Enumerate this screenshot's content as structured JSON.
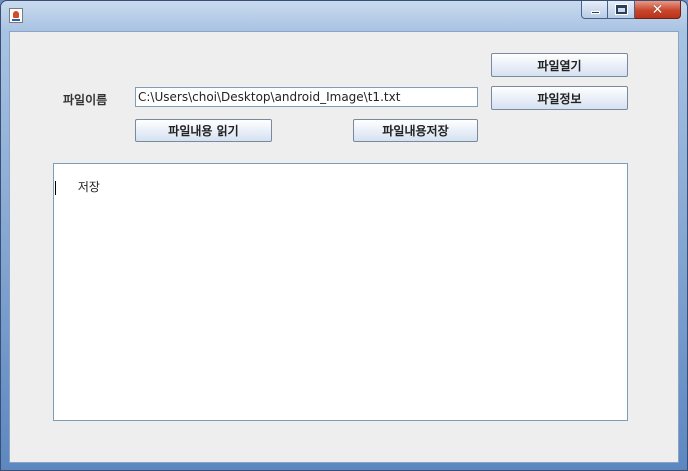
{
  "window": {
    "title": "",
    "controls": {
      "minimize_icon": "minimize-icon",
      "maximize_icon": "maximize-icon",
      "close_icon": "close-icon",
      "close_glyph": "✕"
    },
    "app_icon": "java-coffee-cup-icon"
  },
  "form": {
    "filename_label": "파일이름",
    "filename_value": "C:\\Users\\choi\\Desktop\\android_Image\\t1.txt",
    "open_button": "파일열기",
    "info_button": "파일정보",
    "read_button": "파일내용 읽기",
    "save_button": "파일내용저장"
  },
  "editor": {
    "content": "저장"
  },
  "colors": {
    "titlebar_top": "#c9daee",
    "titlebar_bottom": "#5d87c0",
    "panel_background": "#eeeeee",
    "close_button": "#c9462c"
  }
}
